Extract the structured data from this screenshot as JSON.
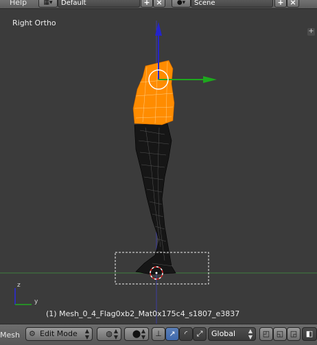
{
  "header": {
    "menu_help": "Help",
    "screen_layout": {
      "icon": "layout-grid-icon",
      "value": "Default"
    },
    "scene": {
      "icon": "scene-icon",
      "value": "Scene"
    }
  },
  "viewport": {
    "view_label": "Right Ortho",
    "object_info": "(1) Mesh_0_4_Flag0xb2_Mat0x175c4_s1807_e3837",
    "axis_x_color": "#2e9a2e",
    "axis_z_color": "#2424cc",
    "selection_color": "#ff8a00",
    "mesh_color": "#111111",
    "gizmo_labels": {
      "z": "z",
      "y": "y"
    }
  },
  "footer": {
    "editor_label": "Mesh",
    "mode": "Edit Mode",
    "orientation": "Global",
    "icons": [
      "object-icon",
      "viewport-shading-icon",
      "pivot-icon",
      "manipulator-icon",
      "translate-icon",
      "rotate-icon",
      "scale-icon",
      "vertex-select-icon",
      "edge-select-icon",
      "face-select-icon"
    ]
  }
}
